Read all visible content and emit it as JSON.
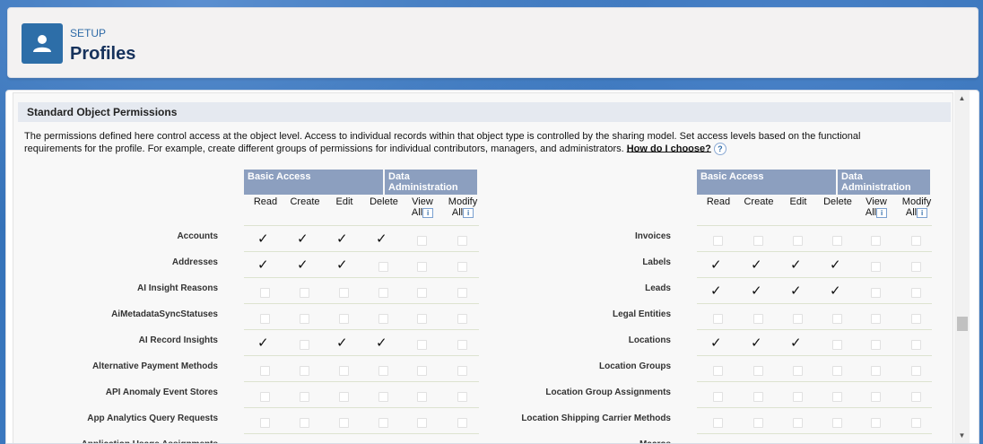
{
  "header": {
    "breadcrumb": "SETUP",
    "title": "Profiles",
    "icon": "user-icon"
  },
  "section": {
    "title": "Standard Object Permissions",
    "description": "The permissions defined here control access at the object level. Access to individual records within that object type is controlled by the sharing model. Set access levels based on the functional requirements for the profile. For example, create different groups of permissions for individual contributors, managers, and administrators.",
    "help_link": "How do I choose?",
    "help_icon": "?"
  },
  "table_headers": {
    "basic_access": "Basic Access",
    "data_admin_line1": "Data",
    "data_admin_line2": "Administration",
    "read": "Read",
    "create": "Create",
    "edit": "Edit",
    "delete": "Delete",
    "view_all_1": "View",
    "view_all_2": "All",
    "modify_all_1": "Modify",
    "modify_all_2": "All",
    "info_icon": "i"
  },
  "left_rows": [
    {
      "label": "Accounts",
      "perms": [
        true,
        true,
        true,
        true,
        false,
        false
      ]
    },
    {
      "label": "Addresses",
      "perms": [
        true,
        true,
        true,
        false,
        false,
        false
      ]
    },
    {
      "label": "AI Insight Reasons",
      "perms": [
        false,
        false,
        false,
        false,
        false,
        false
      ]
    },
    {
      "label": "AiMetadataSyncStatuses",
      "perms": [
        false,
        false,
        false,
        false,
        false,
        false
      ]
    },
    {
      "label": "AI Record Insights",
      "perms": [
        true,
        false,
        true,
        true,
        false,
        false
      ]
    },
    {
      "label": "Alternative Payment Methods",
      "perms": [
        false,
        false,
        false,
        false,
        false,
        false
      ]
    },
    {
      "label": "API Anomaly Event Stores",
      "perms": [
        false,
        false,
        false,
        false,
        false,
        false
      ]
    },
    {
      "label": "App Analytics Query Requests",
      "perms": [
        false,
        false,
        false,
        false,
        false,
        false
      ]
    },
    {
      "label": "Application Usage Assignments",
      "perms": [
        false,
        false,
        false,
        false,
        false,
        false
      ]
    }
  ],
  "right_rows": [
    {
      "label": "Invoices",
      "perms": [
        false,
        false,
        false,
        false,
        false,
        false
      ]
    },
    {
      "label": "Labels",
      "perms": [
        true,
        true,
        true,
        true,
        false,
        false
      ]
    },
    {
      "label": "Leads",
      "perms": [
        true,
        true,
        true,
        true,
        false,
        false
      ]
    },
    {
      "label": "Legal Entities",
      "perms": [
        false,
        false,
        false,
        false,
        false,
        false
      ]
    },
    {
      "label": "Locations",
      "perms": [
        true,
        true,
        true,
        false,
        false,
        false
      ]
    },
    {
      "label": "Location Groups",
      "perms": [
        false,
        false,
        false,
        false,
        false,
        false
      ]
    },
    {
      "label": "Location Group Assignments",
      "perms": [
        false,
        false,
        false,
        false,
        false,
        false
      ]
    },
    {
      "label": "Location Shipping Carrier Methods",
      "perms": [
        false,
        false,
        false,
        false,
        false,
        false
      ]
    },
    {
      "label": "Macros",
      "perms": [
        false,
        false,
        false,
        false,
        false,
        false
      ]
    }
  ],
  "check_glyph": "✓",
  "scrollbar": {
    "up": "▲",
    "down": "▼"
  }
}
